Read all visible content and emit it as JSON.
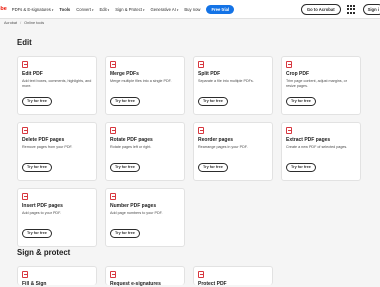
{
  "nav": {
    "brand": "obe",
    "items": [
      {
        "label": "PDFs & E-signatures",
        "dropdown": true
      },
      {
        "label": "Tools",
        "active": true
      },
      {
        "label": "Convert",
        "dropdown": true
      },
      {
        "label": "Edit",
        "dropdown": true
      },
      {
        "label": "Sign & Protect",
        "dropdown": true
      },
      {
        "label": "Generative AI",
        "dropdown": true
      },
      {
        "label": "Buy now"
      }
    ],
    "free_trial": "Free trial",
    "goto": "Go to Acrobat",
    "sign": "Sign i",
    "accent": "#1473e6",
    "brand_color": "#eb1000"
  },
  "breadcrumb": {
    "root": "Acrobat",
    "sep": "/",
    "current": "Online tools"
  },
  "sections": {
    "edit": "Edit",
    "sign": "Sign & protect"
  },
  "try_label": "Try for free",
  "edit_cards": [
    {
      "title": "Edit PDF",
      "desc": "Add text boxes, comments, highlights, and more."
    },
    {
      "title": "Merge PDFs",
      "desc": "Merge multiple files into a single PDF."
    },
    {
      "title": "Split PDF",
      "desc": "Separate a file into multiple PDFs."
    },
    {
      "title": "Crop PDF",
      "desc": "Trim page content, adjust margins, or resize pages."
    },
    {
      "title": "Delete PDF pages",
      "desc": "Remove pages from your PDF."
    },
    {
      "title": "Rotate PDF pages",
      "desc": "Rotate pages left or right."
    },
    {
      "title": "Reorder pages",
      "desc": "Rearrange pages in your PDF."
    },
    {
      "title": "Extract PDF pages",
      "desc": "Create a new PDF of selected pages."
    },
    {
      "title": "Insert PDF pages",
      "desc": "Add pages to your PDF."
    },
    {
      "title": "Number PDF pages",
      "desc": "Add page numbers to your PDF."
    }
  ],
  "sign_cards": [
    {
      "title": "Fill & Sign"
    },
    {
      "title": "Request e-signatures"
    },
    {
      "title": "Protect PDF"
    }
  ]
}
